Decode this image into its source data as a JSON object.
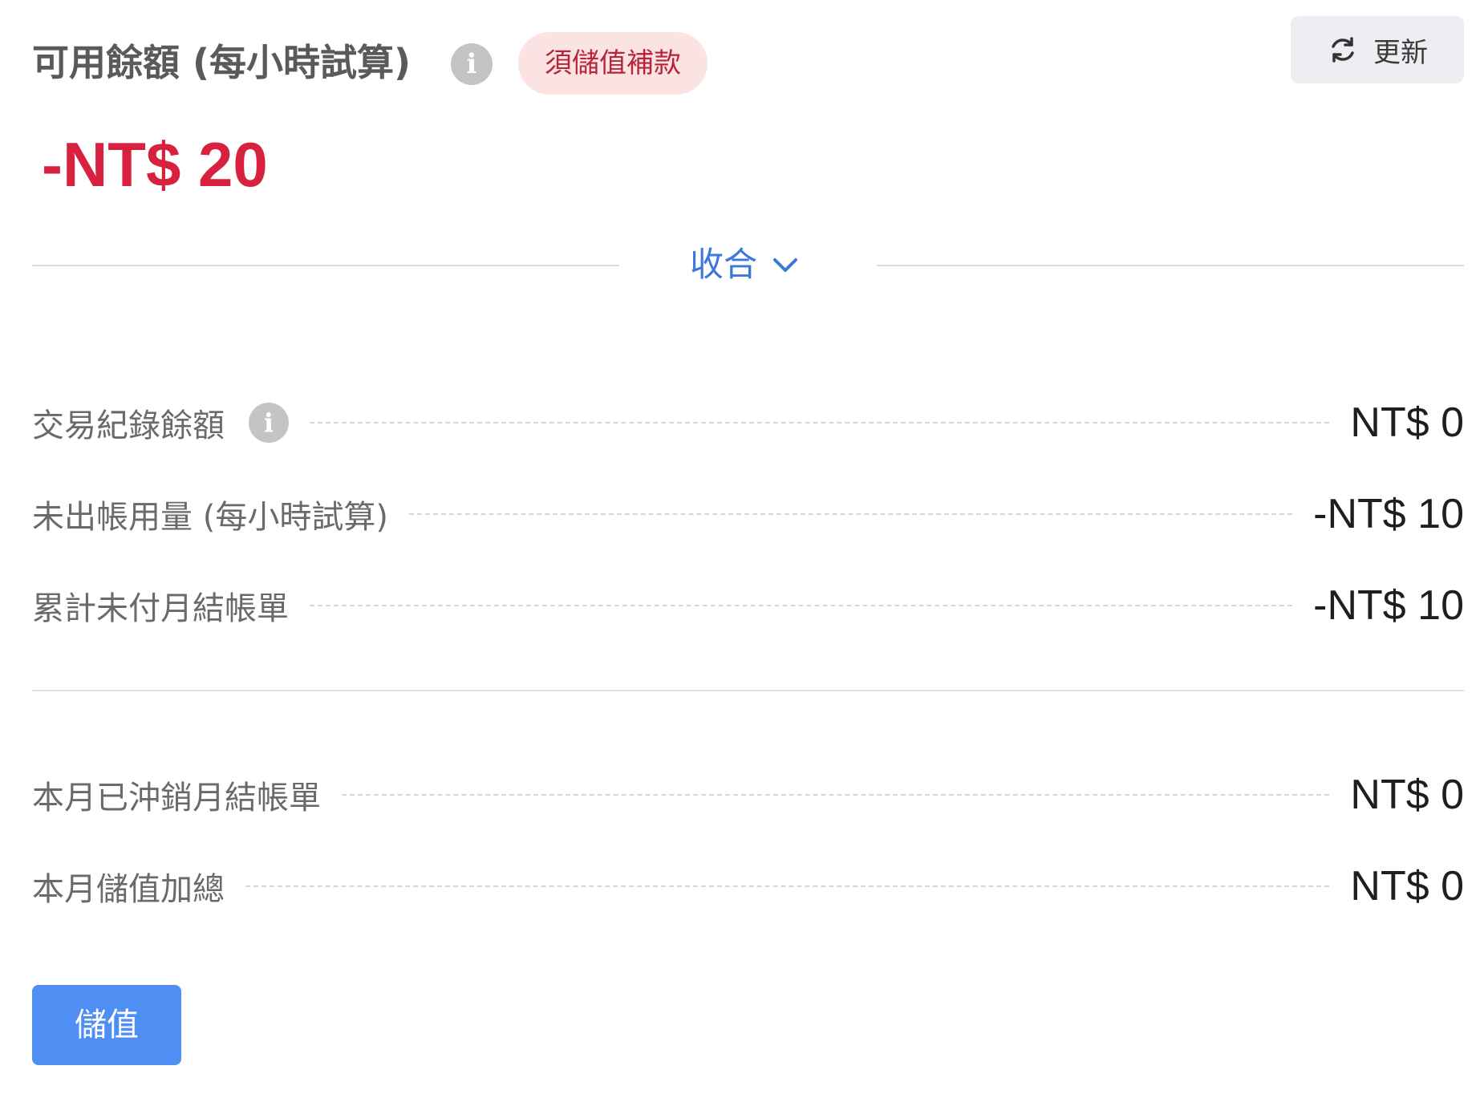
{
  "header": {
    "title": "可用餘額 (每小時試算)",
    "info_icon_glyph": "i",
    "status_badge": "須儲值補款",
    "refresh_label": "更新",
    "refresh_icon": "refresh-icon"
  },
  "balance": {
    "amount": "-NT$ 20",
    "color": "#d8213e"
  },
  "collapse": {
    "label": "收合",
    "icon": "chevron-down-icon",
    "color": "#3b78d8"
  },
  "details": {
    "rows": [
      {
        "label": "交易紀錄餘額",
        "value": "NT$ 0",
        "has_info": true
      },
      {
        "label": "未出帳用量 (每小時試算)",
        "value": "-NT$ 10"
      },
      {
        "label": "累計未付月結帳單",
        "value": "-NT$ 10"
      }
    ]
  },
  "monthly": {
    "rows": [
      {
        "label": "本月已沖銷月結帳單",
        "value": "NT$ 0"
      },
      {
        "label": "本月儲值加總",
        "value": "NT$ 0"
      }
    ]
  },
  "actions": {
    "topup_label": "儲值",
    "topup_color": "#4f8ef3"
  }
}
